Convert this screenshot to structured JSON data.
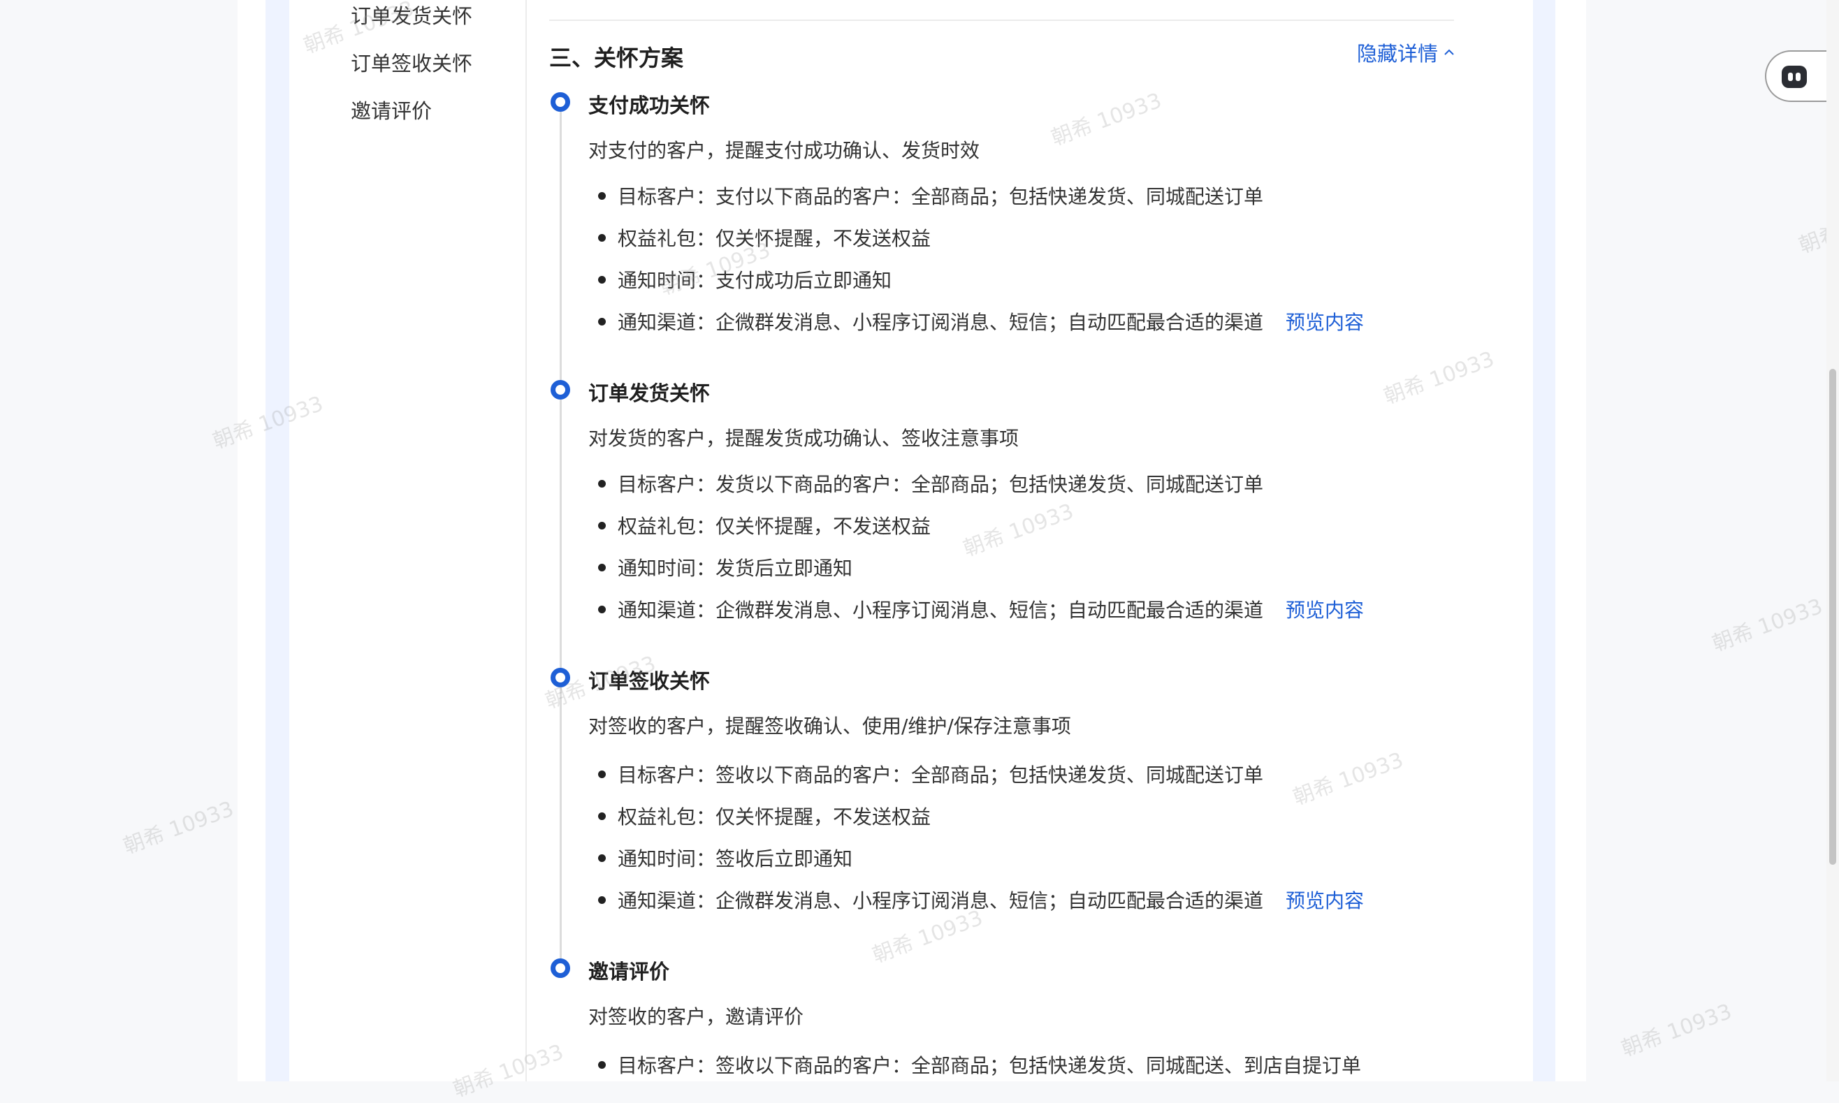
{
  "sidebar": {
    "items": [
      {
        "label": "订单发货关怀"
      },
      {
        "label": "订单签收关怀"
      },
      {
        "label": "邀请评价"
      }
    ]
  },
  "section": {
    "title": "三、关怀方案",
    "toggle_label": "隐藏详情"
  },
  "care_items": [
    {
      "title": "支付成功关怀",
      "desc": "对支付的客户，提醒支付成功确认、发货时效",
      "bullets": [
        "目标客户：支付以下商品的客户：全部商品；包括快递发货、同城配送订单",
        "权益礼包：仅关怀提醒，不发送权益",
        "通知时间：支付成功后立即通知",
        "通知渠道：企微群发消息、小程序订阅消息、短信；自动匹配最合适的渠道"
      ],
      "preview_label": "预览内容"
    },
    {
      "title": "订单发货关怀",
      "desc": "对发货的客户，提醒发货成功确认、签收注意事项",
      "bullets": [
        "目标客户：发货以下商品的客户：全部商品；包括快递发货、同城配送订单",
        "权益礼包：仅关怀提醒，不发送权益",
        "通知时间：发货后立即通知",
        "通知渠道：企微群发消息、小程序订阅消息、短信；自动匹配最合适的渠道"
      ],
      "preview_label": "预览内容"
    },
    {
      "title": "订单签收关怀",
      "desc": "对签收的客户，提醒签收确认、使用/维护/保存注意事项",
      "bullets": [
        "目标客户：签收以下商品的客户：全部商品；包括快递发货、同城配送订单",
        "权益礼包：仅关怀提醒，不发送权益",
        "通知时间：签收后立即通知",
        "通知渠道：企微群发消息、小程序订阅消息、短信；自动匹配最合适的渠道"
      ],
      "preview_label": "预览内容"
    },
    {
      "title": "邀请评价",
      "desc": "对签收的客户，邀请评价",
      "bullets": [
        "目标客户：签收以下商品的客户：全部商品；包括快递发货、同城配送、到店自提订单"
      ]
    }
  ],
  "watermark_text": "朝希 10933",
  "colors": {
    "accent": "#1e5fd6",
    "frame": "#eef3ff",
    "page_bg": "#f7f8fa"
  },
  "icons": {
    "toggle": "chevron-up-icon",
    "assistant": "robot-icon",
    "timeline_node": "timeline-node-icon"
  }
}
